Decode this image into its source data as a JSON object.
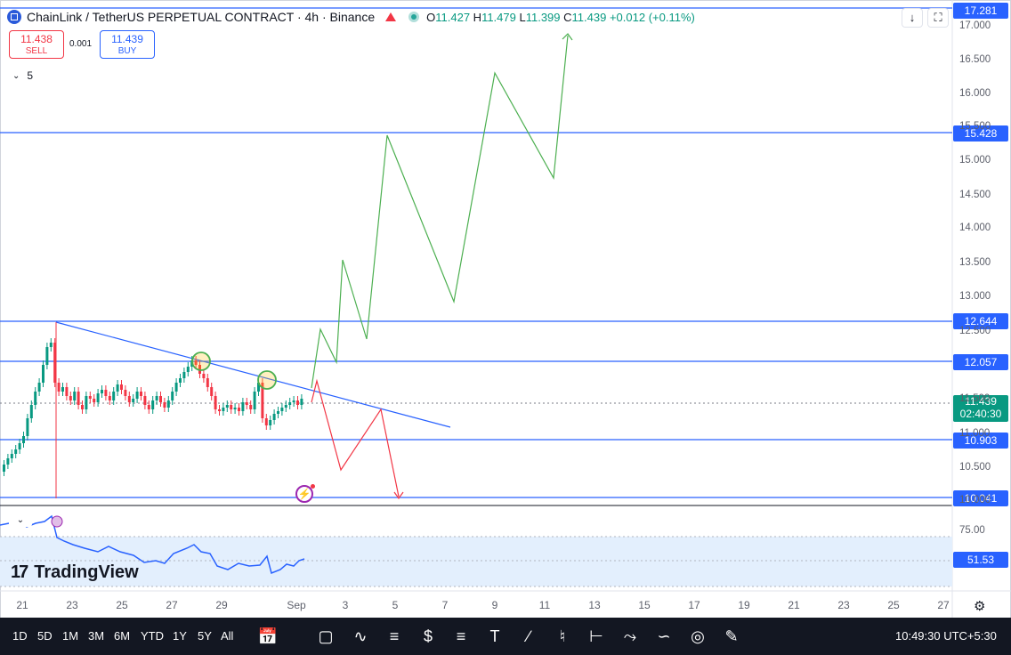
{
  "header": {
    "title": "ChainLink / TetherUS PERPETUAL CONTRACT · 4h · Binance",
    "open_label": "O",
    "open": "11.427",
    "high_label": "H",
    "high": "11.479",
    "low_label": "L",
    "low": "11.399",
    "close_label": "C",
    "close": "11.439",
    "change": "+0.012 (+0.11%)"
  },
  "trade": {
    "sell_price": "11.438",
    "sell_label": "SELL",
    "spread": "0.001",
    "buy_price": "11.439",
    "buy_label": "BUY"
  },
  "indicators_toggle": {
    "count": "5"
  },
  "topbar_buttons": {
    "collapse": "↓",
    "fullscreen": "⛶"
  },
  "price_labels": {
    "top": "17.281",
    "l1": "15.428",
    "l2": "12.644",
    "l3": "12.057",
    "current": "11.439",
    "countdown": "02:40:30",
    "l4": "10.903",
    "l5": "10.041",
    "rsi": "51.53"
  },
  "price_ticks": [
    "17.000",
    "16.500",
    "16.000",
    "15.500",
    "15.000",
    "14.500",
    "14.000",
    "13.500",
    "13.000",
    "12.500",
    "11.500",
    "11.000",
    "10.500",
    "10.000"
  ],
  "rsi_ticks": [
    "75.00"
  ],
  "x_ticks": [
    "21",
    "23",
    "25",
    "27",
    "29",
    "Sep",
    "3",
    "5",
    "7",
    "9",
    "11",
    "13",
    "15",
    "17",
    "19",
    "21",
    "23",
    "25",
    "27"
  ],
  "branding": {
    "name": "TradingView"
  },
  "bottom_toolbar": {
    "timeframes": [
      "1D",
      "5D",
      "1M",
      "3M",
      "6M",
      "YTD",
      "1Y",
      "5Y",
      "All"
    ],
    "clock": "10:49:30 UTC+5:30"
  },
  "colors": {
    "level_line": "#2962ff",
    "up": "#089981",
    "down": "#f23645",
    "projection_up": "#4caf50",
    "projection_down": "#f23645",
    "rsi_line": "#2962ff",
    "rsi_band": "#e3effd",
    "toolbar_bg": "#131722"
  },
  "icons": {
    "symbol": "chainlink-logo-icon",
    "flag": "red-flag-icon",
    "status": "market-open-dot-icon",
    "settings": "gear-icon",
    "alert": "lightning-icon"
  },
  "chart_data": {
    "type": "candlestick",
    "symbol": "LINKUSDT.P",
    "timeframe": "4h",
    "y_range": [
      10.0,
      17.3
    ],
    "horizontal_levels": [
      17.281,
      15.428,
      12.644,
      12.057,
      10.903,
      10.041
    ],
    "current_price": 11.439,
    "trendline": {
      "from": [
        "Aug 22",
        12.68
      ],
      "to": [
        "Sep 7",
        11.0
      ]
    },
    "bullish_projection": [
      11.5,
      12.5,
      12.05,
      13.55,
      12.4,
      15.4,
      12.9,
      16.3,
      14.75,
      16.9
    ],
    "bearish_projection": [
      11.7,
      10.45,
      11.35,
      10.0
    ],
    "rsi": {
      "last": 51.53,
      "levels": [
        70,
        30
      ]
    }
  }
}
